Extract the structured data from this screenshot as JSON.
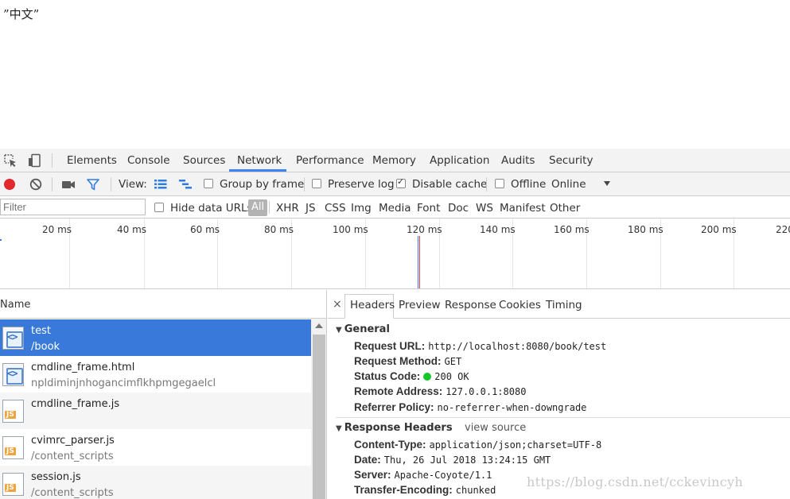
{
  "page": {
    "text": "”中文”"
  },
  "devtools": {
    "tabs": [
      "Elements",
      "Console",
      "Sources",
      "Network",
      "Performance",
      "Memory",
      "Application",
      "Audits",
      "Security"
    ],
    "active_tab": "Network",
    "toolbar": {
      "view_label": "View:",
      "group_by_frame": "Group by frame",
      "preserve_log": "Preserve log",
      "disable_cache": "Disable cache",
      "offline": "Offline",
      "throttle": "Online"
    },
    "filterbar": {
      "placeholder": "Filter",
      "hide_data_urls": "Hide data URLs",
      "types": [
        "All",
        "XHR",
        "JS",
        "CSS",
        "Img",
        "Media",
        "Font",
        "Doc",
        "WS",
        "Manifest",
        "Other"
      ]
    },
    "timeline": {
      "ticks": [
        "20 ms",
        "40 ms",
        "60 ms",
        "80 ms",
        "100 ms",
        "120 ms",
        "140 ms",
        "160 ms",
        "180 ms",
        "200 ms",
        "220"
      ]
    },
    "requests": {
      "header": "Name",
      "rows": [
        {
          "name": "test",
          "path": "/book",
          "type": "html"
        },
        {
          "name": "cmdline_frame.html",
          "path": "npldiminjnhogancimflkhpmgegaelcl",
          "type": "html"
        },
        {
          "name": "cmdline_frame.js",
          "path": "",
          "type": "js"
        },
        {
          "name": "cvimrc_parser.js",
          "path": "/content_scripts",
          "type": "js"
        },
        {
          "name": "session.js",
          "path": "/content_scripts",
          "type": "js"
        }
      ]
    },
    "details": {
      "tabs": [
        "Headers",
        "Preview",
        "Response",
        "Cookies",
        "Timing"
      ],
      "close": "×",
      "general_title": "General",
      "general": [
        {
          "key": "Request URL:",
          "value": "http://localhost:8080/book/test"
        },
        {
          "key": "Request Method:",
          "value": "GET"
        },
        {
          "key": "Status Code:",
          "value": "200 OK"
        },
        {
          "key": "Remote Address:",
          "value": "127.0.0.1:8080"
        },
        {
          "key": "Referrer Policy:",
          "value": "no-referrer-when-downgrade"
        }
      ],
      "response_title": "Response Headers",
      "view_source": "view source",
      "response": [
        {
          "key": "Content-Type:",
          "value": "application/json;charset=UTF-8"
        },
        {
          "key": "Date:",
          "value": "Thu, 26 Jul 2018 13:24:15 GMT"
        },
        {
          "key": "Server:",
          "value": "Apache-Coyote/1.1"
        },
        {
          "key": "Transfer-Encoding:",
          "value": "chunked"
        }
      ]
    }
  },
  "watermark": "https://blog.csdn.net/cckevincyh",
  "colors": {
    "accent": "#3e82f7",
    "selected_row": "#3879d9",
    "record": "#e0282e",
    "status_ok": "#18c52b"
  }
}
